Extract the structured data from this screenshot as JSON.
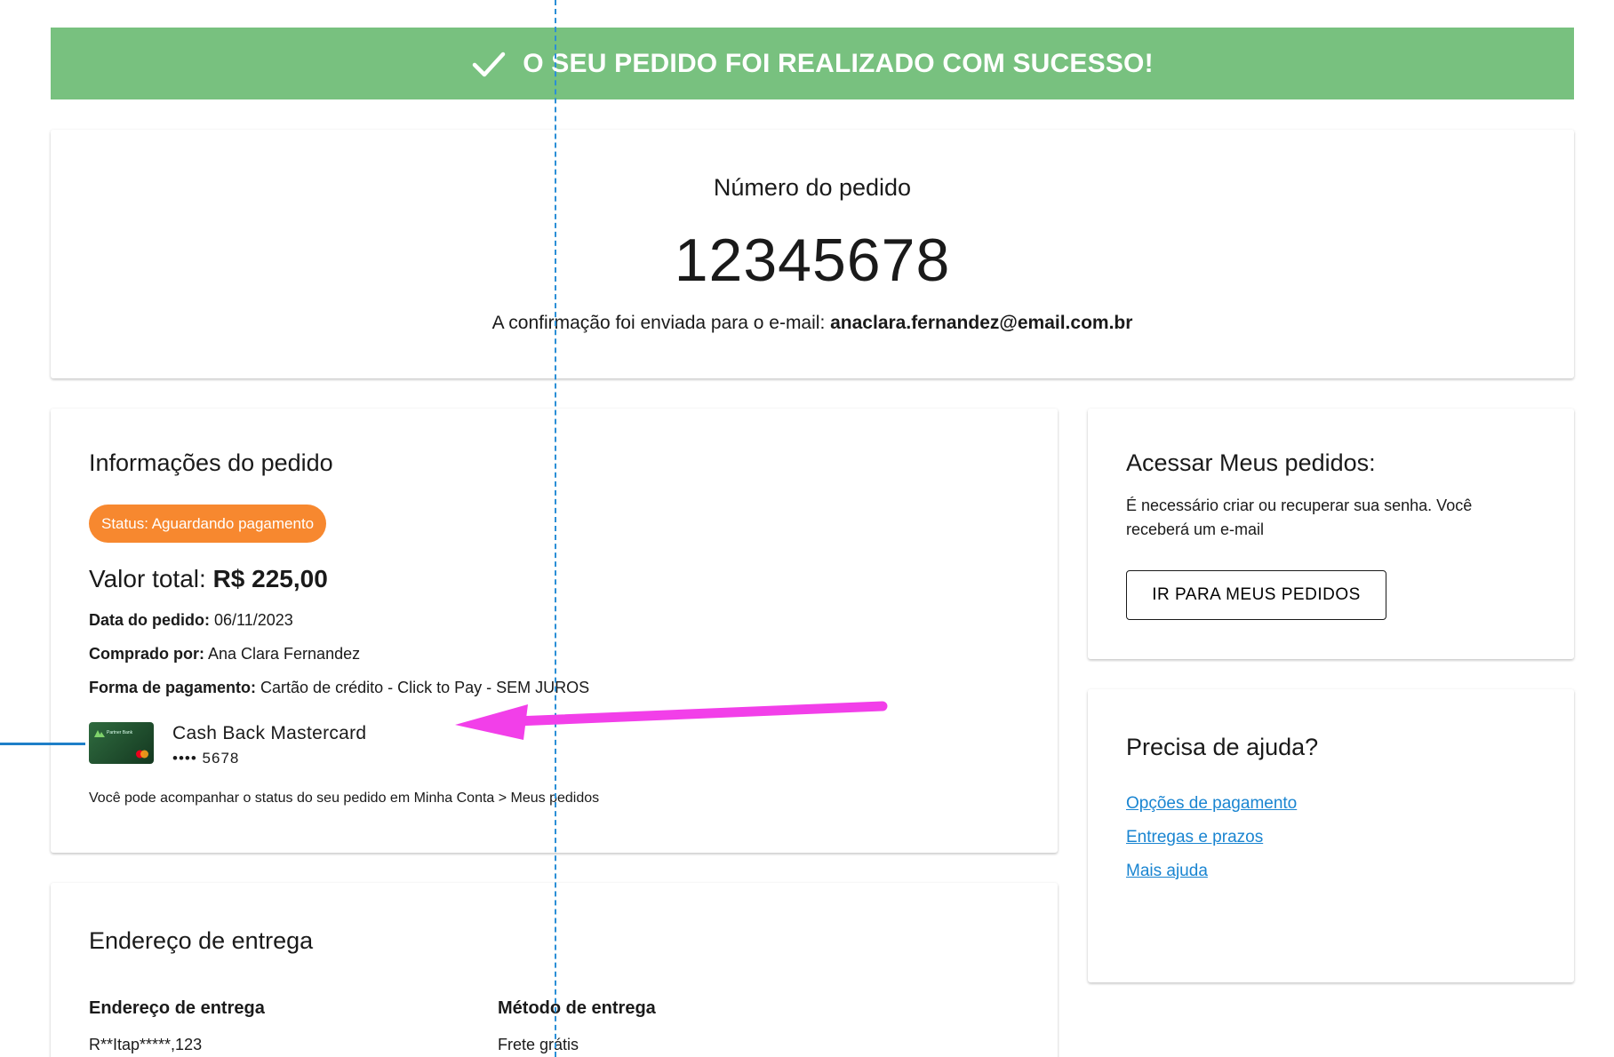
{
  "colors": {
    "banner_bg": "#78c17f",
    "status_badge_bg": "#f7882f",
    "link": "#1a85d1",
    "annotation_arrow": "#f23fe9"
  },
  "banner": {
    "icon": "check-icon",
    "message": "O SEU PEDIDO FOI REALIZADO COM SUCESSO!"
  },
  "order_number": {
    "label": "Número do pedido",
    "value": "12345678",
    "confirmation_prefix": "A confirmação foi enviada para o e-mail: ",
    "email": "anaclara.fernandez@email.com.br"
  },
  "order_info": {
    "title": "Informações do pedido",
    "status": "Status: Aguardando pagamento",
    "total_label": "Valor total: ",
    "total_value": "R$ 225,00",
    "date_label": "Data do pedido:",
    "date_value": " 06/11/2023",
    "buyer_label": "Comprado por:",
    "buyer_value": " Ana Clara Fernandez",
    "payment_label": "Forma de pagamento:",
    "payment_value": " Cartão de crédito - Click to Pay - SEM JUROS",
    "card": {
      "name": "Cash Back Mastercard",
      "masked_digits": "•••• 5678",
      "bank_name": "Partner Bank"
    },
    "tracking_note": "Você pode acompanhar o status do seu pedido em Minha Conta > Meus pedidos"
  },
  "delivery": {
    "title": "Endereço de entrega",
    "address_heading": "Endereço de entrega",
    "address_value": "R**Itap*****,123",
    "method_heading": "Método de entrega",
    "method_value": "Frete grátis"
  },
  "access_orders": {
    "title": "Acessar Meus pedidos:",
    "description": "É necessário criar ou recuperar sua senha. Você receberá um e-mail",
    "button_label": "IR PARA MEUS PEDIDOS"
  },
  "help": {
    "title": "Precisa de ajuda?",
    "links": [
      "Opções de pagamento",
      "Entregas e prazos",
      "Mais ajuda"
    ]
  }
}
